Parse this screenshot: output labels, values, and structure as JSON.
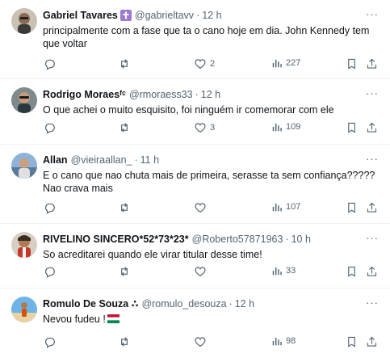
{
  "more_glyph": "···",
  "tweets": [
    {
      "name": "Gabriel Tavares",
      "handle": "@gabrieltavv",
      "separator": "·",
      "time": "12 h",
      "text": "principalmente com a fase que ta o cano hoje em dia. John Kennedy tem que voltar",
      "likes": "2",
      "views": "227"
    },
    {
      "name": "Rodrigo Moraes",
      "name_suffix": "ᶠᶜ",
      "handle": "@rmoraess33",
      "separator": "·",
      "time": "12 h",
      "text": "O que achei o muito esquisito, foi ninguém ir comemorar com ele",
      "likes": "3",
      "views": "109"
    },
    {
      "name": "Allan",
      "handle": "@vieiraallan_",
      "separator": "·",
      "time": "11 h",
      "text": "E o cano que nao chuta mais de primeira, serasse ta sem confiança?????\nNao crava mais",
      "likes": "",
      "views": "107"
    },
    {
      "name": "RIVELINO SINCERO*52*73*23*",
      "handle": "@Roberto57871963",
      "separator": "·",
      "time": "10 h",
      "text": "So acreditarei quando ele virar titular desse time!",
      "likes": "",
      "views": "33"
    },
    {
      "name": "Romulo De Souza ∴",
      "handle": "@romulo_desouza",
      "separator": "·",
      "time": "12 h",
      "text": "Nevou fudeu !",
      "likes": "",
      "views": "98"
    }
  ]
}
